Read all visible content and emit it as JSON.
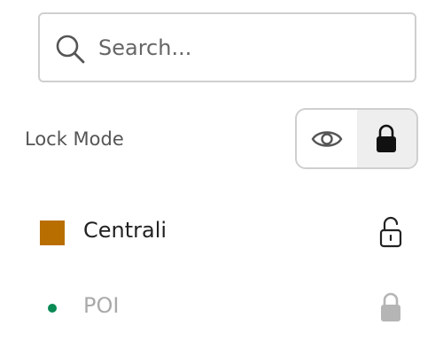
{
  "search": {
    "placeholder": "Search..."
  },
  "lock_mode": {
    "label": "Lock Mode",
    "options": [
      {
        "icon": "eye-icon",
        "selected": false
      },
      {
        "icon": "lock-closed-icon",
        "selected": true
      }
    ]
  },
  "layers": [
    {
      "name": "Centrali",
      "marker": "square",
      "color": "#b86e00",
      "lock_icon": "lock-open-icon",
      "enabled": true
    },
    {
      "name": "POI",
      "marker": "dot",
      "color": "#0a8a55",
      "lock_icon": "lock-closed-icon",
      "enabled": false
    }
  ]
}
